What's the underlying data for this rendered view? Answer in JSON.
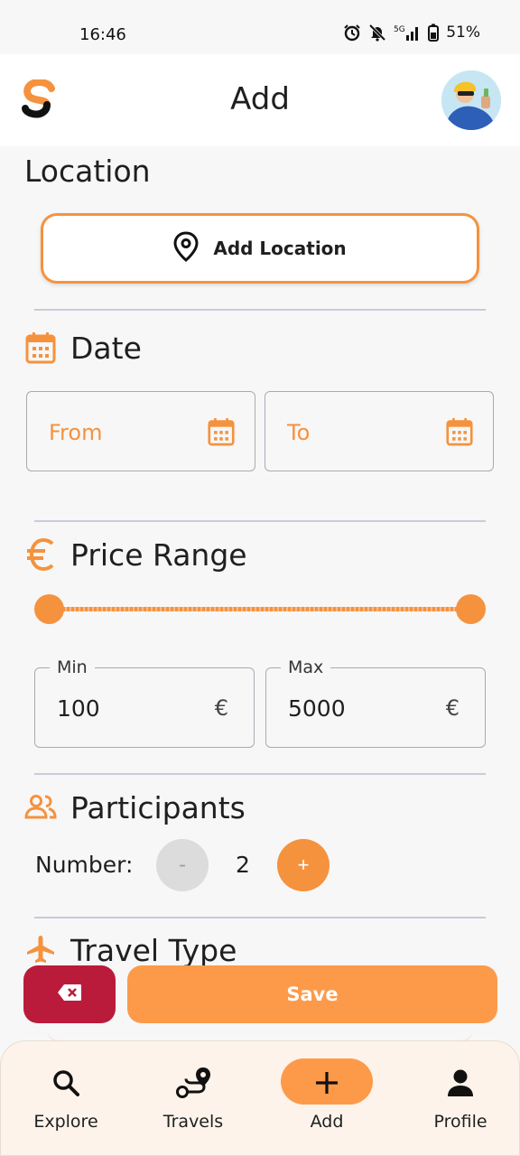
{
  "status_bar": {
    "time": "16:46",
    "battery": "51%",
    "network": "5G"
  },
  "app_bar": {
    "title": "Add"
  },
  "location": {
    "title": "Location",
    "button_label": "Add Location"
  },
  "date": {
    "title": "Date",
    "from_label": "From",
    "to_label": "To"
  },
  "price": {
    "title": "Price Range",
    "min_label": "Min",
    "min_value": "100",
    "max_label": "Max",
    "max_value": "5000",
    "currency": "€",
    "slider_min": 100,
    "slider_max": 5000
  },
  "participants": {
    "title": "Participants",
    "number_label": "Number:",
    "value": "2",
    "minus": "-",
    "plus": "+"
  },
  "travel_type": {
    "title": "Travel Type"
  },
  "actions": {
    "save_label": "Save"
  },
  "nav": {
    "items": [
      {
        "label": "Explore",
        "icon": "search-icon"
      },
      {
        "label": "Travels",
        "icon": "route-icon"
      },
      {
        "label": "Add",
        "icon": "plus-icon",
        "active": true
      },
      {
        "label": "Profile",
        "icon": "person-icon"
      }
    ]
  },
  "colors": {
    "accent": "#f5923e",
    "save": "#fd9a4a",
    "delete": "#bb1b3a",
    "nav_bg": "#fdf3ea"
  }
}
